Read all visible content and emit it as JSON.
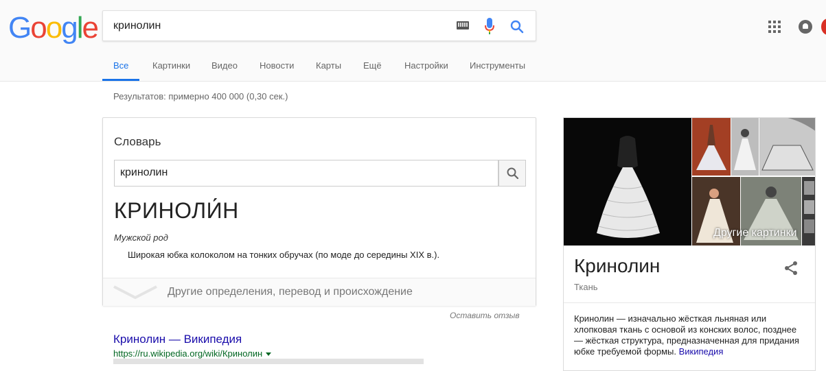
{
  "header": {
    "logo_letters": [
      {
        "ch": "G",
        "color": "#4285F4"
      },
      {
        "ch": "o",
        "color": "#EA4335"
      },
      {
        "ch": "o",
        "color": "#FBBC05"
      },
      {
        "ch": "g",
        "color": "#4285F4"
      },
      {
        "ch": "l",
        "color": "#34A853"
      },
      {
        "ch": "e",
        "color": "#EA4335"
      }
    ],
    "search_query": "кринолин",
    "icons": {
      "keyboard": "keyboard-icon",
      "mic": "microphone-icon",
      "search": "search-icon",
      "apps": "apps-grid-icon",
      "notifications": "notifications-icon"
    }
  },
  "tabs": [
    {
      "label": "Все",
      "active": true
    },
    {
      "label": "Картинки"
    },
    {
      "label": "Видео"
    },
    {
      "label": "Новости"
    },
    {
      "label": "Карты"
    },
    {
      "label": "Ещё"
    },
    {
      "label": "Настройки"
    },
    {
      "label": "Инструменты"
    }
  ],
  "results_count": "Результатов: примерно 400 000 (0,30 сек.)",
  "dictionary": {
    "title": "Словарь",
    "input_value": "кринолин",
    "word": "КРИНОЛИ́Н",
    "gender": "Мужской род",
    "definition": "Широкая юбка колоколом на тонких обручах (по моде до середины XIX в.).",
    "more_label": "Другие определения, перевод и происхождение"
  },
  "feedback_label": "Оставить отзыв",
  "result": {
    "title": "Кринолин — Википедия",
    "url": "https://ru.wikipedia.org/wiki/Кринолин"
  },
  "knowledge_panel": {
    "more_images_label": "Другие картинки",
    "name": "Кринолин",
    "type": "Ткань",
    "description": "Кринолин — изначально жёсткая льняная или хлопковая ткань с основой из конских волос, позднее — жёсткая структура, предназначенная для придания юбке требуемой формы.",
    "description_accent": "и́",
    "source_link": "Википедия"
  }
}
